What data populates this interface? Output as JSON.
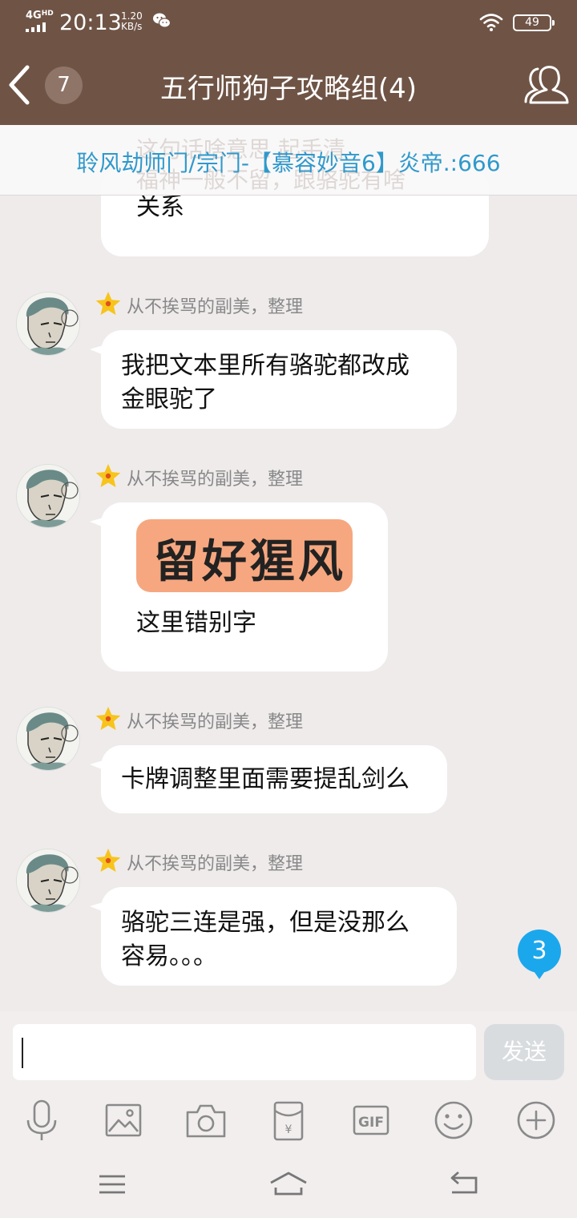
{
  "status_bar": {
    "network": "4G",
    "network_hd": "HD",
    "time": "20:13",
    "speed_value": "1.20",
    "speed_unit": "KB/s",
    "battery": "49"
  },
  "header": {
    "unread_count": "7",
    "title": "五行师狗子攻略组(4)"
  },
  "notice": {
    "text": "聆风劫师门/宗门-【慕容妙音6】炎帝.:666",
    "bg_line1": "这句话啥意思        起手清",
    "bg_line2": "福神一般不留，跟骆驼有啥"
  },
  "messages": [
    {
      "lines": [
        "关系"
      ]
    },
    {
      "sender": "从不挨骂的副美，整理",
      "lines": [
        "我把文本里所有骆驼都改成",
        "金眼驼了"
      ]
    },
    {
      "sender": "从不挨骂的副美，整理",
      "image_text": "留好猩风",
      "lines": [
        "这里错别字"
      ]
    },
    {
      "sender": "从不挨骂的副美，整理",
      "lines": [
        "卡牌调整里面需要提乱剑么"
      ]
    },
    {
      "sender": "从不挨骂的副美，整理",
      "lines": [
        "骆驼三连是强，但是没那么",
        "容易。。。"
      ]
    }
  ],
  "new_message_badge": "3",
  "input": {
    "placeholder": "",
    "send_label": "发送"
  },
  "toolbar": [
    "microphone-icon",
    "image-icon",
    "camera-icon",
    "red-packet-icon",
    "gif-icon",
    "emoji-icon",
    "plus-icon"
  ],
  "colors": {
    "header_bg": "#6f5446",
    "notice_text": "#2f99cc",
    "badge_blue": "#1ba7ec",
    "chat_bg": "#efebeb"
  }
}
